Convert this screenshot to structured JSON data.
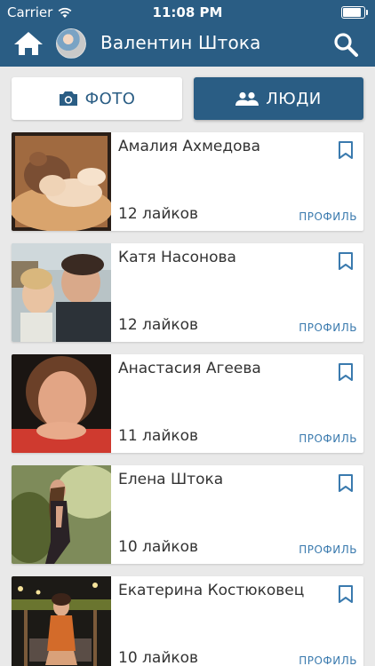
{
  "status_bar": {
    "carrier": "Carrier",
    "time": "11:08 PM"
  },
  "header": {
    "title": "Валентин Штока"
  },
  "tabs": {
    "photo_label": "ФОТО",
    "people_label": "ЛЮДИ",
    "active": "people"
  },
  "people": [
    {
      "name": "Амалия Ахмедова",
      "likes": "12 лайков",
      "profile_label": "ПРОФИЛЬ",
      "photo": "cat-photo"
    },
    {
      "name": "Катя Насонова",
      "likes": "12 лайков",
      "profile_label": "ПРОФИЛЬ",
      "photo": "couple-photo"
    },
    {
      "name": "Анастасия Агеева",
      "likes": "11 лайков",
      "profile_label": "ПРОФИЛЬ",
      "photo": "portrait-photo"
    },
    {
      "name": "Елена Штока",
      "likes": "10 лайков",
      "profile_label": "ПРОФИЛЬ",
      "photo": "outdoor-photo"
    },
    {
      "name": "Екатерина Костюковец",
      "likes": "10 лайков",
      "profile_label": "ПРОФИЛЬ",
      "photo": "night-photo"
    }
  ],
  "colors": {
    "primary": "#2a5d84",
    "link": "#3a7aae",
    "background": "#e9e9e9"
  }
}
